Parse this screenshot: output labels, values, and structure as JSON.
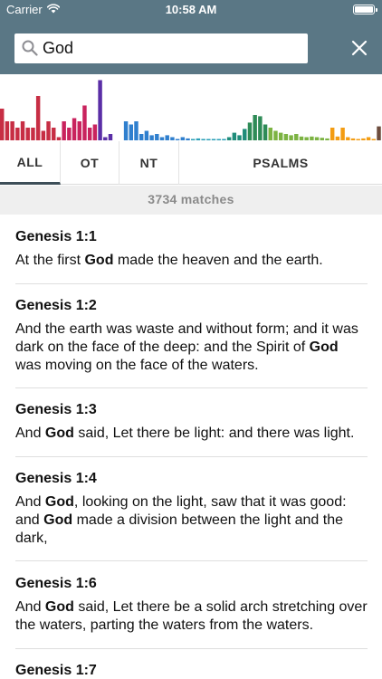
{
  "status_bar": {
    "carrier": "Carrier",
    "time": "10:58 AM",
    "battery_level": 1.0
  },
  "search": {
    "query": "God",
    "search_icon": "search-icon",
    "clear_icon": "close-icon"
  },
  "colors": {
    "header_bg": "#5a7785",
    "tab_indicator": "#3d4e58",
    "matches_bg": "#efefef",
    "matches_text": "#8a8a8a"
  },
  "histogram": {
    "segments": [
      {
        "color": "#c72e44",
        "values": [
          0.5,
          0.3,
          0.3,
          0.2,
          0.3,
          0.2,
          0.2,
          0.7,
          0.15,
          0.3,
          0.2,
          0.05
        ]
      },
      {
        "color": "#c9235e",
        "values": [
          0.3,
          0.2,
          0.35,
          0.3,
          0.55,
          0.2,
          0.25
        ]
      },
      {
        "color": "#5a2ea6",
        "values": [
          0.95,
          0.05,
          0.1
        ]
      },
      {
        "color": "#6f4fb5",
        "values": [
          0.0,
          0.0
        ]
      },
      {
        "color": "#2f7fce",
        "values": [
          0.3,
          0.25,
          0.3,
          0.1,
          0.15,
          0.08,
          0.1,
          0.05,
          0.08,
          0.05,
          0.02,
          0.05,
          0.03
        ]
      },
      {
        "color": "#2a9fb7",
        "values": [
          0.02,
          0.03,
          0.01,
          0.02,
          0.01,
          0.02,
          0.02
        ]
      },
      {
        "color": "#1f8c7a",
        "values": [
          0.05,
          0.12,
          0.08,
          0.18
        ]
      },
      {
        "color": "#2e8b57",
        "values": [
          0.28,
          0.4,
          0.38,
          0.25
        ]
      },
      {
        "color": "#7cb342",
        "values": [
          0.2,
          0.15,
          0.12,
          0.1,
          0.08,
          0.1,
          0.06,
          0.05,
          0.06,
          0.05,
          0.04,
          0.03
        ]
      },
      {
        "color": "#f39c12",
        "values": [
          0.2,
          0.06,
          0.2,
          0.05,
          0.03,
          0.02,
          0.03,
          0.05,
          0.02
        ]
      },
      {
        "color": "#6d4c3d",
        "values": [
          0.22
        ]
      }
    ]
  },
  "tabs": [
    {
      "label": "ALL",
      "active": true
    },
    {
      "label": "OT",
      "active": false
    },
    {
      "label": "NT",
      "active": false
    },
    {
      "label": "PSALMS",
      "active": false
    }
  ],
  "matches_label": "3734 matches",
  "results": [
    {
      "reference": "Genesis 1:1",
      "parts": [
        "At the first ",
        "God",
        " made the heaven and the earth."
      ]
    },
    {
      "reference": "Genesis 1:2",
      "parts": [
        "And the earth was waste and without form; and it was dark on the face of the deep: and the Spirit of ",
        "God",
        " was moving on the face of the waters."
      ]
    },
    {
      "reference": "Genesis 1:3",
      "parts": [
        "And ",
        "God",
        " said, Let there be light: and there was light."
      ]
    },
    {
      "reference": "Genesis 1:4",
      "parts": [
        "And ",
        "God",
        ", looking on the light, saw that it was good: and ",
        "God",
        " made a division between the light and the dark,"
      ]
    },
    {
      "reference": "Genesis 1:6",
      "parts": [
        "And ",
        "God",
        " said, Let there be a solid arch stretching over the waters, parting the waters from the waters."
      ]
    },
    {
      "reference": "Genesis 1:7",
      "parts": []
    }
  ]
}
